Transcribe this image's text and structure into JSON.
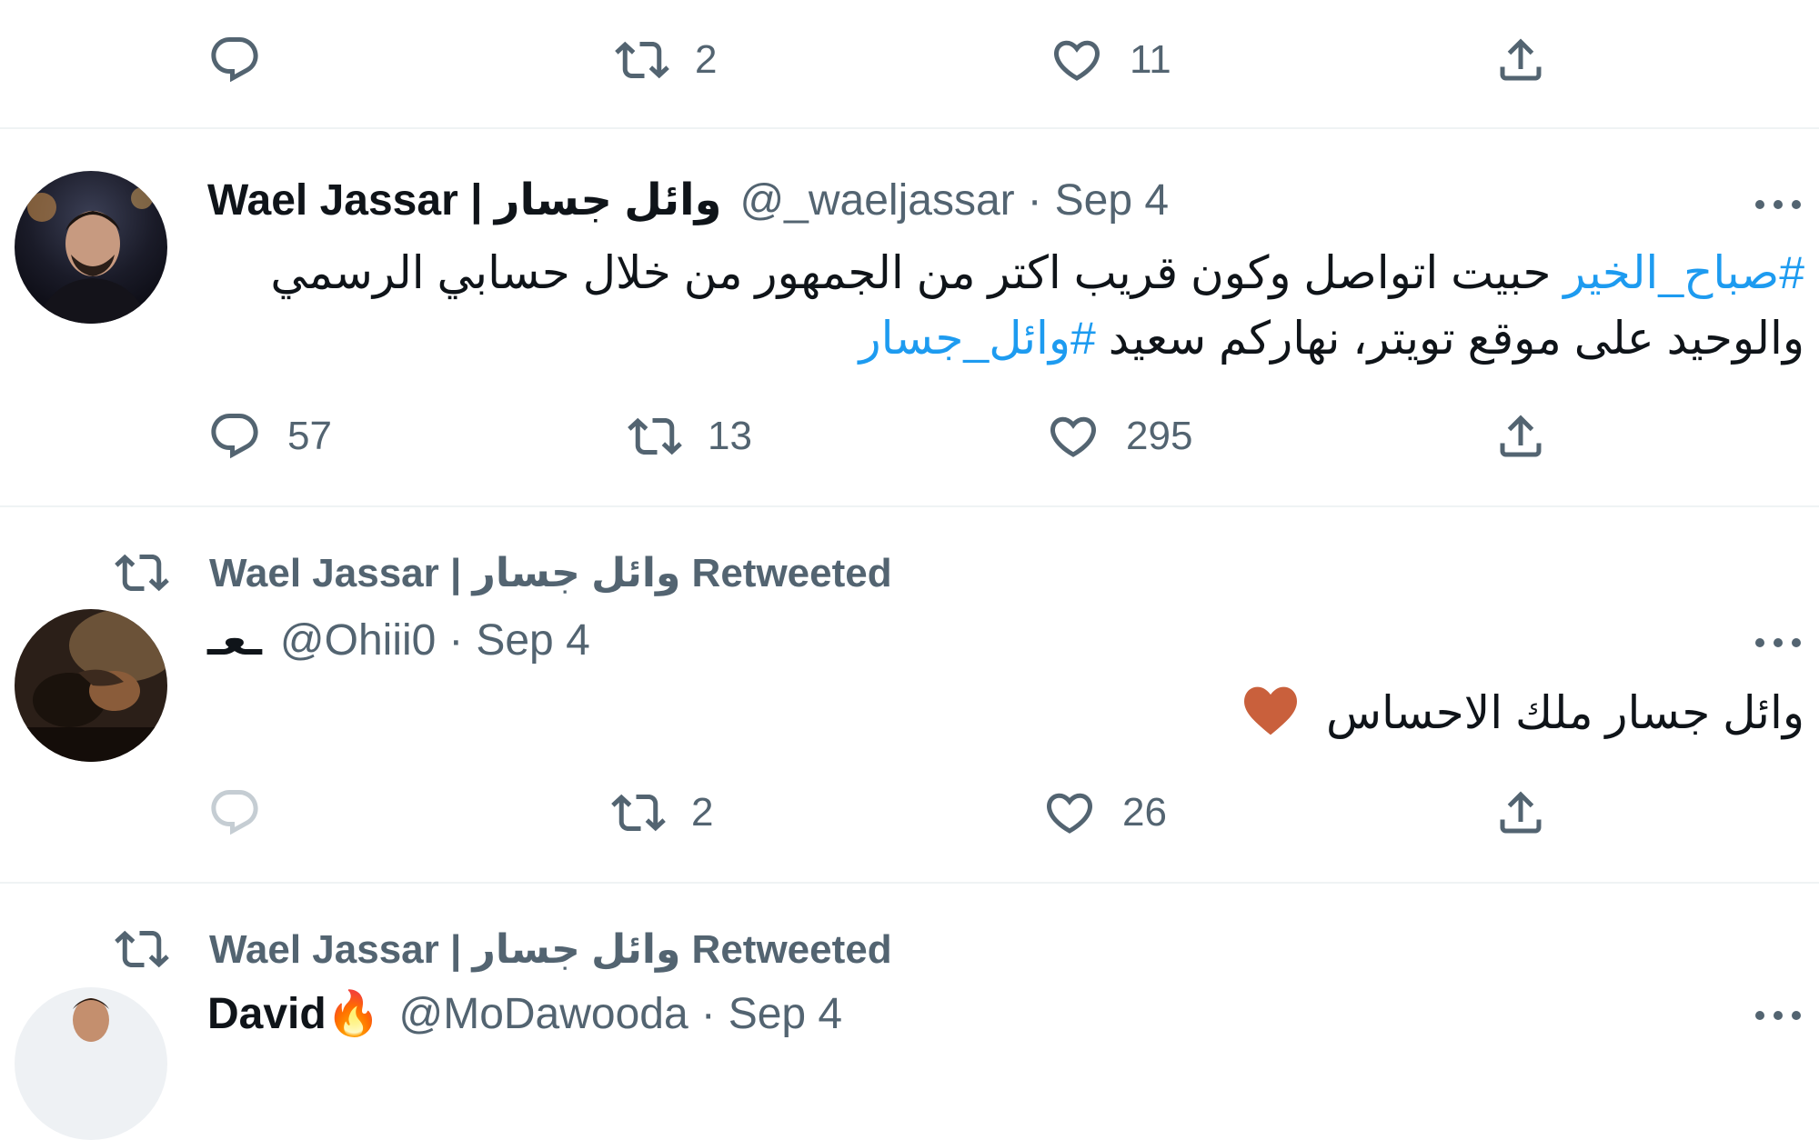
{
  "top_actions": {
    "reply_count": "",
    "retweet_count": "2",
    "like_count": "11"
  },
  "tweet1": {
    "author_name": "Wael Jassar | وائل جسار",
    "handle": "@_waeljassar",
    "date": "Sep 4",
    "hashtag_start": "#صباح_الخير",
    "text_middle": " حبيت اتواصل وكون قريب اكتر من الجمهور من خلال حسابي الرسمي والوحيد على موقع تويتر، نهاركم سعيد ",
    "hashtag_end": "#وائل_جسار",
    "reply_count": "57",
    "retweet_count": "13",
    "like_count": "295"
  },
  "tweet2": {
    "retweeted_by": "Wael Jassar | وائل جسار Retweeted",
    "author_name": "ـعـ",
    "handle": "@Ohiii0",
    "date": "Sep 4",
    "text": "وائل جسار ملك الاحساس",
    "reply_count": "",
    "retweet_count": "2",
    "like_count": "26"
  },
  "tweet3": {
    "retweeted_by": "Wael Jassar | وائل جسار Retweeted",
    "author_name": "David🔥",
    "handle": "@MoDawooda",
    "date": "Sep 4"
  },
  "icons": {
    "reply": "reply-icon",
    "retweet": "retweet-icon",
    "like": "heart-icon",
    "share": "share-icon",
    "more": "more-icon"
  },
  "colors": {
    "hashtag": "#1d9bf0",
    "secondary_text": "#536471",
    "heart_emoji": "#c9603c"
  }
}
